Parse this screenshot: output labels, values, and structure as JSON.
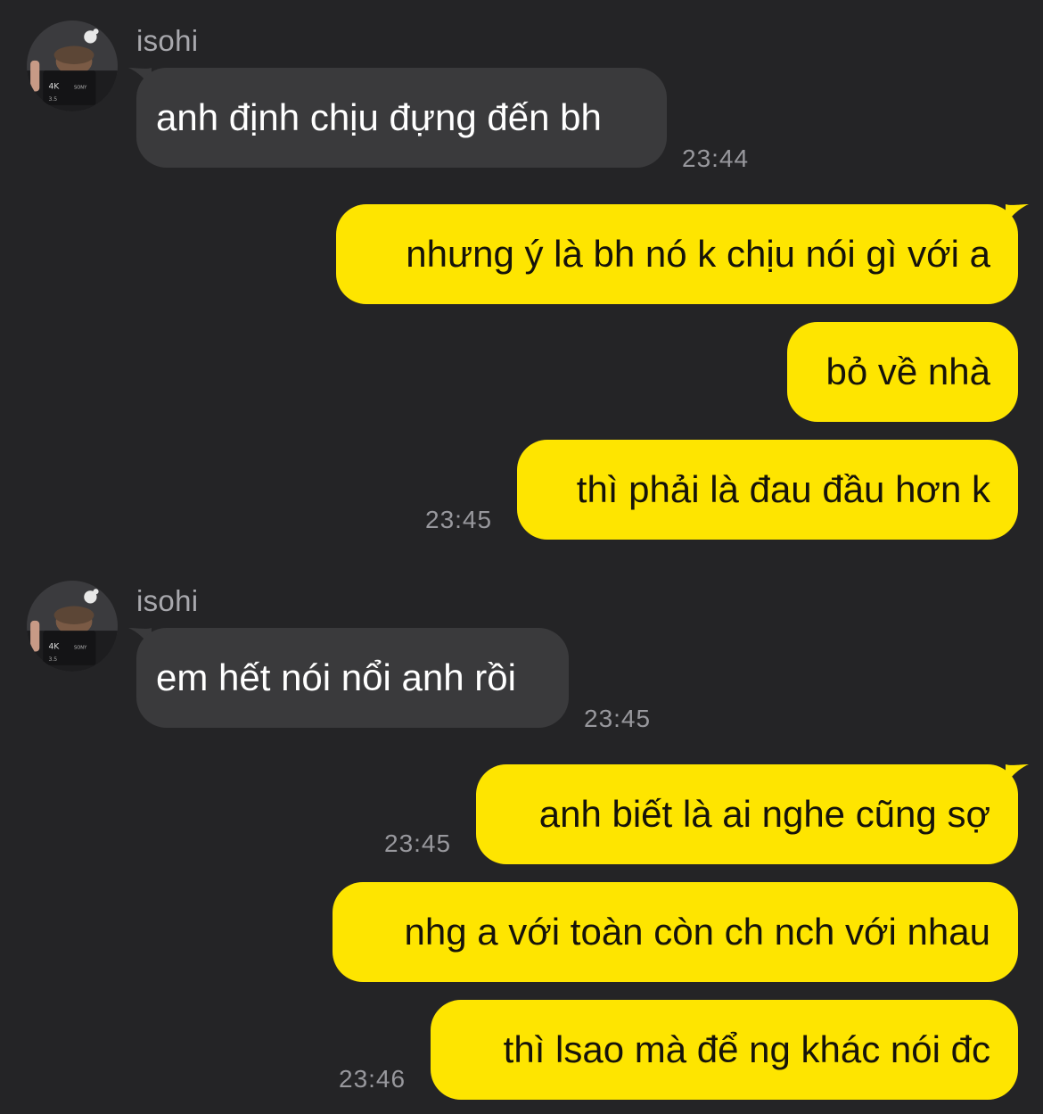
{
  "colors": {
    "background": "#242426",
    "incoming_bubble": "#3a3a3c",
    "outgoing_bubble": "#fee500",
    "timestamp": "#98989d",
    "sender_name": "#a8a8ad"
  },
  "messages": [
    {
      "direction": "in",
      "sender": "isohi",
      "text": "anh định chịu đựng đến bh",
      "time": "23:44"
    },
    {
      "direction": "out",
      "text": "nhưng ý là bh nó k chịu nói gì với a"
    },
    {
      "direction": "out",
      "text": "bỏ về nhà"
    },
    {
      "direction": "out",
      "text": "thì phải là đau đầu hơn k",
      "time": "23:45"
    },
    {
      "direction": "in",
      "sender": "isohi",
      "text": "em hết nói nổi anh rồi",
      "time": "23:45"
    },
    {
      "direction": "out",
      "text": "anh biết là ai nghe cũng sợ",
      "time": "23:45"
    },
    {
      "direction": "out",
      "text": "nhg a với toàn còn ch nch với nhau"
    },
    {
      "direction": "out",
      "text": "thì lsao mà để ng khác nói đc",
      "time": "23:46"
    }
  ]
}
